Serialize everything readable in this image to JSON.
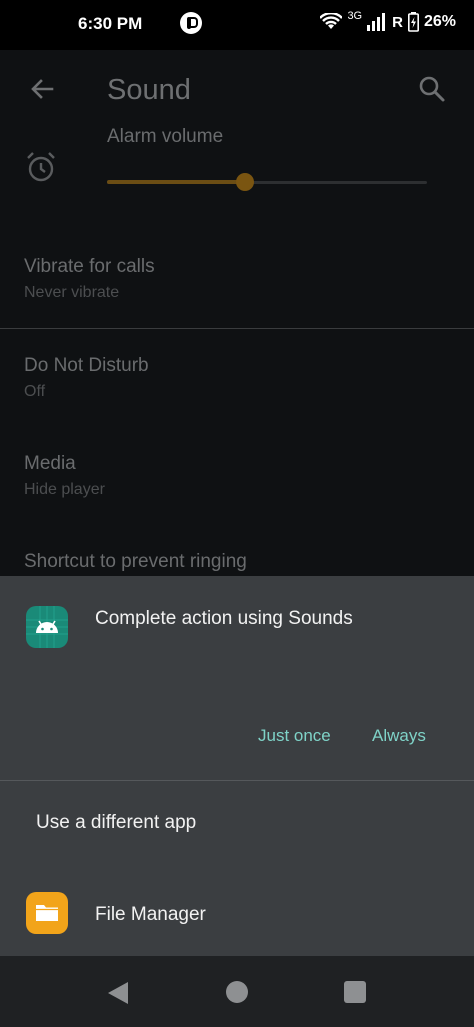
{
  "status_bar": {
    "time": "6:30 PM",
    "network": "3G",
    "roaming": "R",
    "battery": "26%"
  },
  "app_bar": {
    "title": "Sound",
    "back_icon": "arrow-back-icon",
    "search_icon": "search-icon"
  },
  "settings": {
    "alarm_volume": {
      "label": "Alarm volume",
      "level": 0.43,
      "icon": "alarm-clock-icon"
    },
    "vibrate_for_calls": {
      "title": "Vibrate for calls",
      "subtitle": "Never vibrate"
    },
    "do_not_disturb": {
      "title": "Do Not Disturb",
      "subtitle": "Off"
    },
    "media": {
      "title": "Media",
      "subtitle": "Hide player"
    },
    "shortcut": {
      "title": "Shortcut to prevent ringing"
    }
  },
  "sheet": {
    "title": "Complete action using Sounds",
    "app_icon": "android-icon",
    "just_once_label": "Just once",
    "always_label": "Always",
    "other_app_header": "Use a different app",
    "apps": [
      {
        "label": "File Manager",
        "icon": "folder-icon"
      }
    ]
  },
  "colors": {
    "accent": "#7fd3c8",
    "slider": "#7a5511",
    "sheet_bg": "#3b3e41",
    "android_icon_bg": "#1a8a78",
    "file_manager_icon_bg": "#f2a41a"
  }
}
